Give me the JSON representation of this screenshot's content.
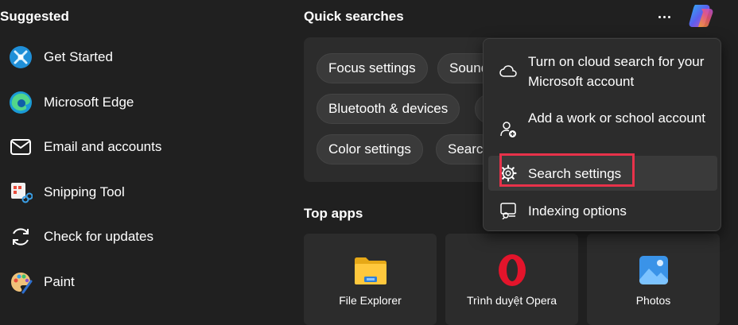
{
  "suggested": {
    "title": "Suggested",
    "items": [
      {
        "label": "Get Started",
        "icon": "get-started-icon"
      },
      {
        "label": "Microsoft Edge",
        "icon": "edge-icon"
      },
      {
        "label": "Email and accounts",
        "icon": "mail-icon"
      },
      {
        "label": "Snipping Tool",
        "icon": "snipping-tool-icon"
      },
      {
        "label": "Check for updates",
        "icon": "refresh-icon"
      },
      {
        "label": "Paint",
        "icon": "paint-palette-icon"
      }
    ]
  },
  "quick_searches": {
    "title": "Quick searches",
    "chips": [
      "Focus settings",
      "Sound",
      "Bluetooth & devices",
      "Color settings",
      "Search"
    ]
  },
  "top_apps": {
    "title": "Top apps",
    "apps": [
      {
        "label": "File Explorer",
        "icon": "folder-icon"
      },
      {
        "label": "Trình duyệt Opera",
        "icon": "opera-icon"
      },
      {
        "label": "Photos",
        "icon": "photos-icon"
      }
    ]
  },
  "menu": {
    "items": [
      {
        "label": "Turn on cloud search for your Microsoft account",
        "icon": "cloud-icon"
      },
      {
        "label": "Add a work or school account",
        "icon": "add-person-icon"
      },
      {
        "label": "Search settings",
        "icon": "gear-icon"
      },
      {
        "label": "Indexing options",
        "icon": "indexing-icon"
      }
    ]
  },
  "colors": {
    "background": "#202020",
    "panel": "#2c2c2c",
    "highlight": "#e8324a"
  }
}
